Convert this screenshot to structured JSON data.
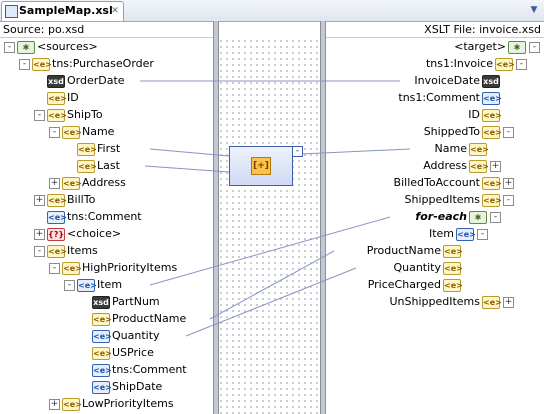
{
  "tab": {
    "title": "SampleMap.xsl",
    "close": "✕"
  },
  "dropdown": "▼",
  "source_header": "Source: po.xsd",
  "target_header": "XSLT File: invoice.xsd",
  "source_tree": [
    {
      "label": "<sources>",
      "icon": "root",
      "exp": "-"
    },
    {
      "label": "tns:PurchaseOrder",
      "icon": "elem",
      "exp": "-"
    },
    {
      "label": "OrderDate",
      "icon": "type",
      "exp": ""
    },
    {
      "label": "ID",
      "icon": "elem",
      "exp": ""
    },
    {
      "label": "ShipTo",
      "icon": "elem",
      "exp": "-"
    },
    {
      "label": "Name",
      "icon": "elem",
      "exp": "-"
    },
    {
      "label": "First",
      "icon": "elem",
      "exp": ""
    },
    {
      "label": "Last",
      "icon": "elem",
      "exp": ""
    },
    {
      "label": "Address",
      "icon": "elem",
      "exp": "+"
    },
    {
      "label": "BillTo",
      "icon": "elem",
      "exp": "+"
    },
    {
      "label": "tns:Comment",
      "icon": "cmnt",
      "exp": ""
    },
    {
      "label": "<choice>",
      "icon": "choice",
      "exp": "+"
    },
    {
      "label": "Items",
      "icon": "elem",
      "exp": "-"
    },
    {
      "label": "HighPriorityItems",
      "icon": "elem",
      "exp": "-"
    },
    {
      "label": "Item",
      "icon": "cmnt",
      "exp": "-"
    },
    {
      "label": "PartNum",
      "icon": "type",
      "exp": ""
    },
    {
      "label": "ProductName",
      "icon": "elem",
      "exp": ""
    },
    {
      "label": "Quantity",
      "icon": "cmnt",
      "exp": ""
    },
    {
      "label": "USPrice",
      "icon": "elem",
      "exp": ""
    },
    {
      "label": "tns:Comment",
      "icon": "cmnt",
      "exp": ""
    },
    {
      "label": "ShipDate",
      "icon": "cmnt",
      "exp": ""
    },
    {
      "label": "LowPriorityItems",
      "icon": "elem",
      "exp": "+"
    }
  ],
  "target_tree": [
    {
      "label": "<target>",
      "icon": "root",
      "exp": "-"
    },
    {
      "label": "tns1:Invoice",
      "icon": "elem",
      "exp": "-"
    },
    {
      "label": "InvoiceDate",
      "icon": "type",
      "exp": ""
    },
    {
      "label": "tns1:Comment",
      "icon": "cmnt",
      "exp": ""
    },
    {
      "label": "ID",
      "icon": "elem",
      "exp": ""
    },
    {
      "label": "ShippedTo",
      "icon": "elem",
      "exp": "-"
    },
    {
      "label": "Name",
      "icon": "elem",
      "exp": ""
    },
    {
      "label": "Address",
      "icon": "elem",
      "exp": "+"
    },
    {
      "label": "BilledToAccount",
      "icon": "elem",
      "exp": "+"
    },
    {
      "label": "ShippedItems",
      "icon": "elem",
      "exp": "-"
    },
    {
      "label": "for-each",
      "icon": "root",
      "exp": "-"
    },
    {
      "label": "Item",
      "icon": "cmnt",
      "exp": "-"
    },
    {
      "label": "ProductName",
      "icon": "elem",
      "exp": ""
    },
    {
      "label": "Quantity",
      "icon": "elem",
      "exp": ""
    },
    {
      "label": "PriceCharged",
      "icon": "elem",
      "exp": ""
    },
    {
      "label": "UnShippedItems",
      "icon": "elem",
      "exp": "+"
    }
  ],
  "icons": {
    "elem": "<e>",
    "attr": "@",
    "type": "xsd",
    "cmnt": "<e>",
    "choice": "{?}",
    "root": "✱"
  },
  "function_node": {
    "icon": "[+]",
    "collapse": "-"
  },
  "colors": {
    "link": "#8894c8",
    "selection": "#3e5ea8"
  }
}
